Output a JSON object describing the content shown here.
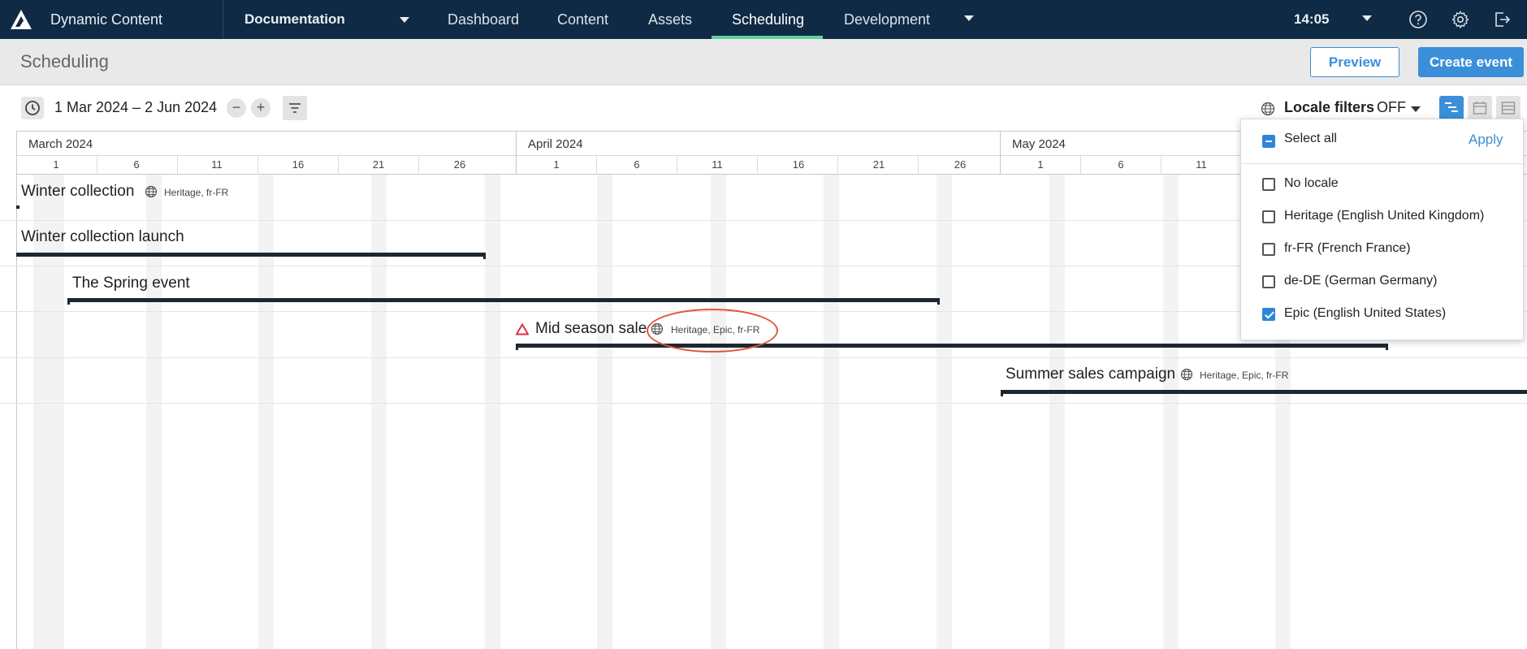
{
  "topnav": {
    "app_name": "Dynamic Content",
    "hub": "Documentation",
    "items": [
      "Dashboard",
      "Content",
      "Assets",
      "Scheduling",
      "Development"
    ],
    "active": "Scheduling",
    "clock": "14:05",
    "icons": [
      "help-icon",
      "gear-icon",
      "logout-icon"
    ]
  },
  "page": {
    "title": "Scheduling",
    "preview_label": "Preview",
    "create_label": "Create event"
  },
  "toolbar": {
    "date_range": "1 Mar 2024 – 2 Jun 2024",
    "zoom_out": "−",
    "zoom_in": "+",
    "locale_filters_label": "Locale filters",
    "locale_filters_state": "OFF"
  },
  "timeline": {
    "months": [
      "March 2024",
      "April 2024",
      "May 2024"
    ],
    "march_days": [
      "1",
      "6",
      "11",
      "16",
      "21",
      "26"
    ],
    "april_days": [
      "1",
      "6",
      "11",
      "16",
      "21",
      "26"
    ],
    "may_days": [
      "1",
      "6",
      "11"
    ],
    "events": [
      {
        "title": "Winter collection",
        "locales": "Heritage, fr-FR"
      },
      {
        "title": "Winter collection launch",
        "locales": ""
      },
      {
        "title": "The Spring event",
        "locales": ""
      },
      {
        "title": "Mid season sale",
        "locales": "Heritage, Epic, fr-FR",
        "warning": true
      },
      {
        "title": "Summer sales campaign",
        "locales": "Heritage, Epic, fr-FR"
      }
    ]
  },
  "locale_menu": {
    "select_all": "Select all",
    "apply": "Apply",
    "options": [
      {
        "label": "No locale",
        "checked": false
      },
      {
        "label": "Heritage (English United Kingdom)",
        "checked": false
      },
      {
        "label": "fr-FR (French France)",
        "checked": false
      },
      {
        "label": "de-DE (German Germany)",
        "checked": false
      },
      {
        "label": "Epic (English United States)",
        "checked": true
      }
    ]
  }
}
